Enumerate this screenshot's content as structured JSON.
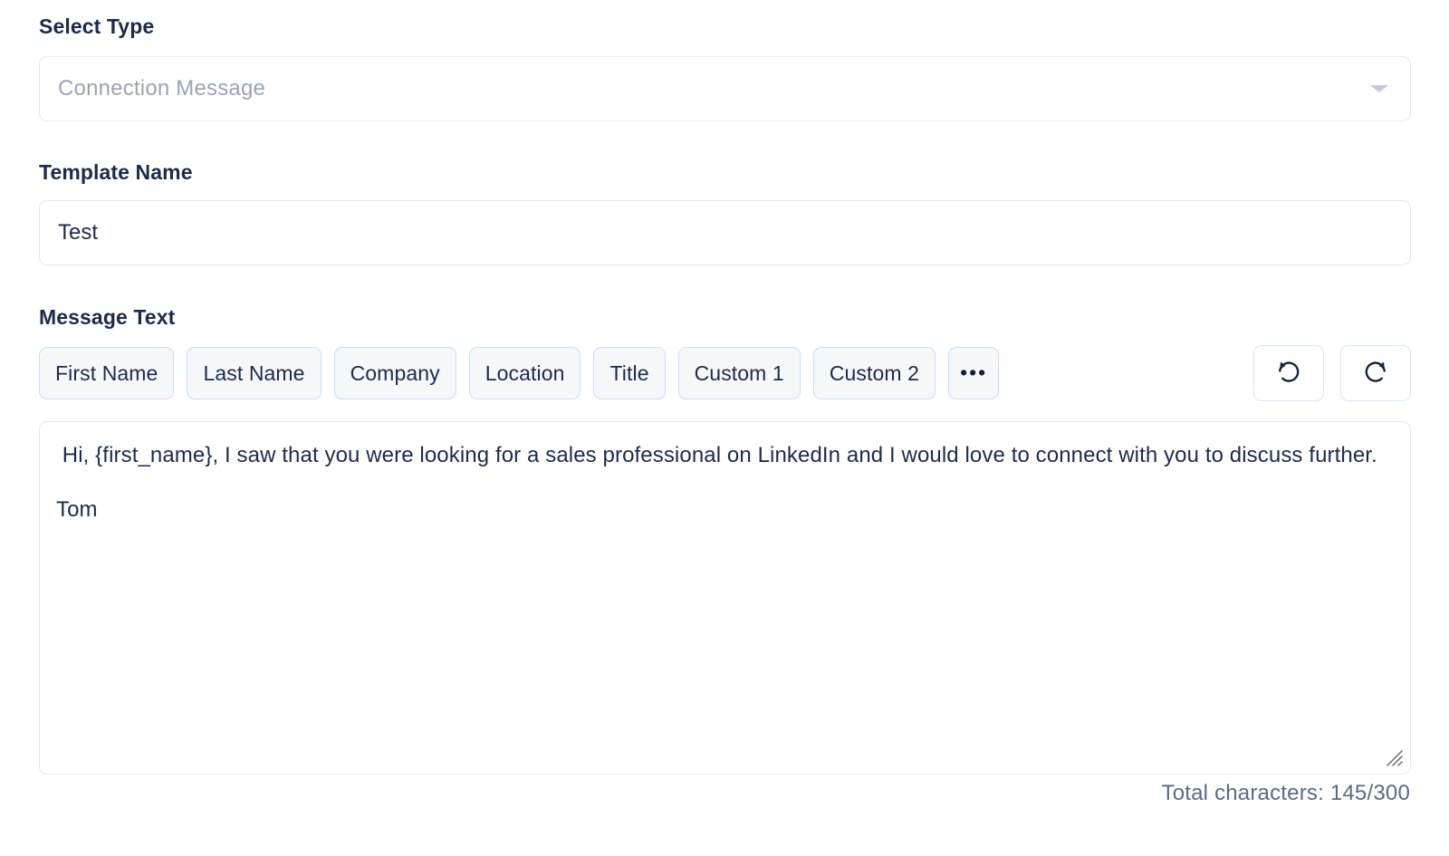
{
  "form": {
    "select_type": {
      "label": "Select Type",
      "placeholder": "Connection Message",
      "value": "",
      "chevron_icon": "chevron-down-icon"
    },
    "template_name": {
      "label": "Template Name",
      "value": "Test",
      "placeholder": ""
    },
    "message_text": {
      "label": "Message Text",
      "value": " Hi, {first_name}, I saw that you were looking for a sales professional on LinkedIn and I would love to connect with you to discuss further.\n\nTom",
      "placeholder": "",
      "resize_handle_icon": "resize-grip-icon"
    }
  },
  "toolbar": {
    "merge_tags": [
      {
        "label": "First Name"
      },
      {
        "label": "Last Name"
      },
      {
        "label": "Company"
      },
      {
        "label": "Location"
      },
      {
        "label": "Title"
      },
      {
        "label": "Custom 1"
      },
      {
        "label": "Custom 2"
      }
    ],
    "more_label": "•••",
    "undo": {
      "icon": "undo-icon",
      "label": "Undo"
    },
    "redo": {
      "icon": "redo-icon",
      "label": "Redo"
    }
  },
  "counter": {
    "text": "Total characters: 145/300",
    "used": 145,
    "limit": 300
  },
  "colors": {
    "text_primary": "#1c2b4b",
    "placeholder": "#9aa3b5",
    "border": "#e4e7ec",
    "chip_border": "#c7ddf7",
    "chip_background": "#f6f7f9",
    "counter_text": "#5a6a87",
    "background": "#ffffff"
  }
}
